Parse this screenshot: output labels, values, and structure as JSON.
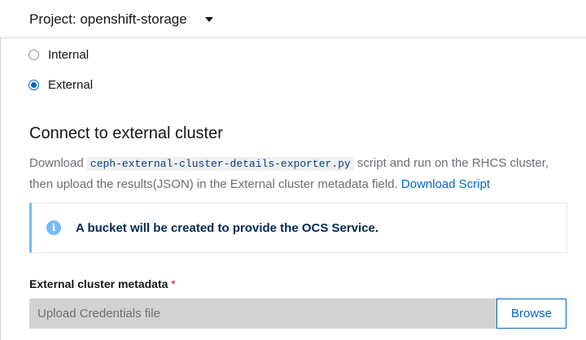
{
  "header": {
    "project_label": "Project: openshift-storage"
  },
  "mode": {
    "options": [
      {
        "label": "Internal",
        "selected": false
      },
      {
        "label": "External",
        "selected": true
      }
    ]
  },
  "section": {
    "title": "Connect to external cluster",
    "desc_prefix": "Download",
    "script_name": "ceph-external-cluster-details-exporter.py",
    "desc_middle": "script and run on the RHCS cluster, then upload the results(JSON) in the External cluster metadata field.",
    "download_link": "Download Script"
  },
  "alert": {
    "text": "A bucket will be created to provide the OCS Service.",
    "icon": "info-icon",
    "color": "#73bcf7"
  },
  "metadata": {
    "label": "External cluster metadata",
    "required_mark": "*",
    "placeholder": "Upload Credentials file",
    "browse_label": "Browse"
  },
  "colors": {
    "accent": "#0066cc",
    "required": "#c9190b",
    "alert_title": "#002952"
  }
}
